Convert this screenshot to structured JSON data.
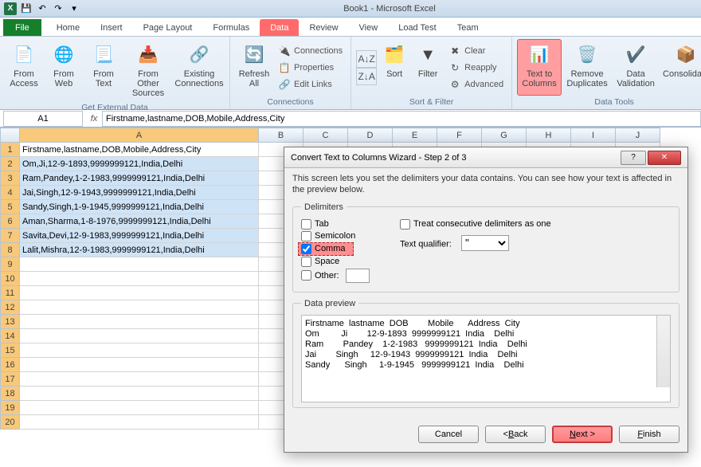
{
  "window": {
    "title": "Book1 - Microsoft Excel"
  },
  "tabs": {
    "file": "File",
    "home": "Home",
    "insert": "Insert",
    "pagelayout": "Page Layout",
    "formulas": "Formulas",
    "data": "Data",
    "review": "Review",
    "view": "View",
    "loadtest": "Load Test",
    "team": "Team"
  },
  "ribbon": {
    "ext_group": "Get External Data",
    "from_access": "From Access",
    "from_web": "From Web",
    "from_text": "From Text",
    "from_other": "From Other Sources",
    "existing": "Existing Connections",
    "refresh": "Refresh All",
    "conn_group": "Connections",
    "connections": "Connections",
    "properties": "Properties",
    "editlinks": "Edit Links",
    "sort": "Sort",
    "filter": "Filter",
    "sf_group": "Sort & Filter",
    "clear": "Clear",
    "reapply": "Reapply",
    "advanced": "Advanced",
    "ttc": "Text to Columns",
    "remove_dup": "Remove Duplicates",
    "data_val": "Data Validation",
    "consolidate": "Consolidate",
    "dt_group": "Data Tools"
  },
  "namebox": "A1",
  "formula": "Firstname,lastname,DOB,Mobile,Address,City",
  "colA_header": "A",
  "cols": [
    "B",
    "C",
    "D",
    "E",
    "F",
    "G",
    "H",
    "I",
    "J"
  ],
  "rows": [
    "Firstname,lastname,DOB,Mobile,Address,City",
    "Om,Ji,12-9-1893,9999999121,India,Delhi",
    "Ram,Pandey,1-2-1983,9999999121,India,Delhi",
    "Jai,Singh,12-9-1943,9999999121,India,Delhi",
    "Sandy,Singh,1-9-1945,9999999121,India,Delhi",
    "Aman,Sharma,1-8-1976,9999999121,India,Delhi",
    "Savita,Devi,12-9-1983,9999999121,India,Delhi",
    "Lalit,Mishra,12-9-1983,9999999121,India,Delhi"
  ],
  "dialog": {
    "title": "Convert Text to Columns Wizard - Step 2 of 3",
    "desc": "This screen lets you set the delimiters your data contains. You can see how your text is affected in the preview below.",
    "legend_delim": "Delimiters",
    "tab": "Tab",
    "semicolon": "Semicolon",
    "comma": "Comma",
    "space": "Space",
    "other": "Other:",
    "treat": "Treat consecutive delimiters as one",
    "tq_label": "Text qualifier:",
    "tq_value": "\"",
    "legend_preview": "Data preview",
    "preview": "Firstname  lastname  DOB        Mobile      Address  City\nOm         Ji        12-9-1893  9999999121  India    Delhi\nRam        Pandey    1-2-1983   9999999121  India    Delhi\nJai        Singh     12-9-1943  9999999121  India    Delhi\nSandy      Singh     1-9-1945   9999999121  India    Delhi",
    "cancel": "Cancel",
    "back": "< Back",
    "next": "Next >",
    "finish": "Finish"
  }
}
